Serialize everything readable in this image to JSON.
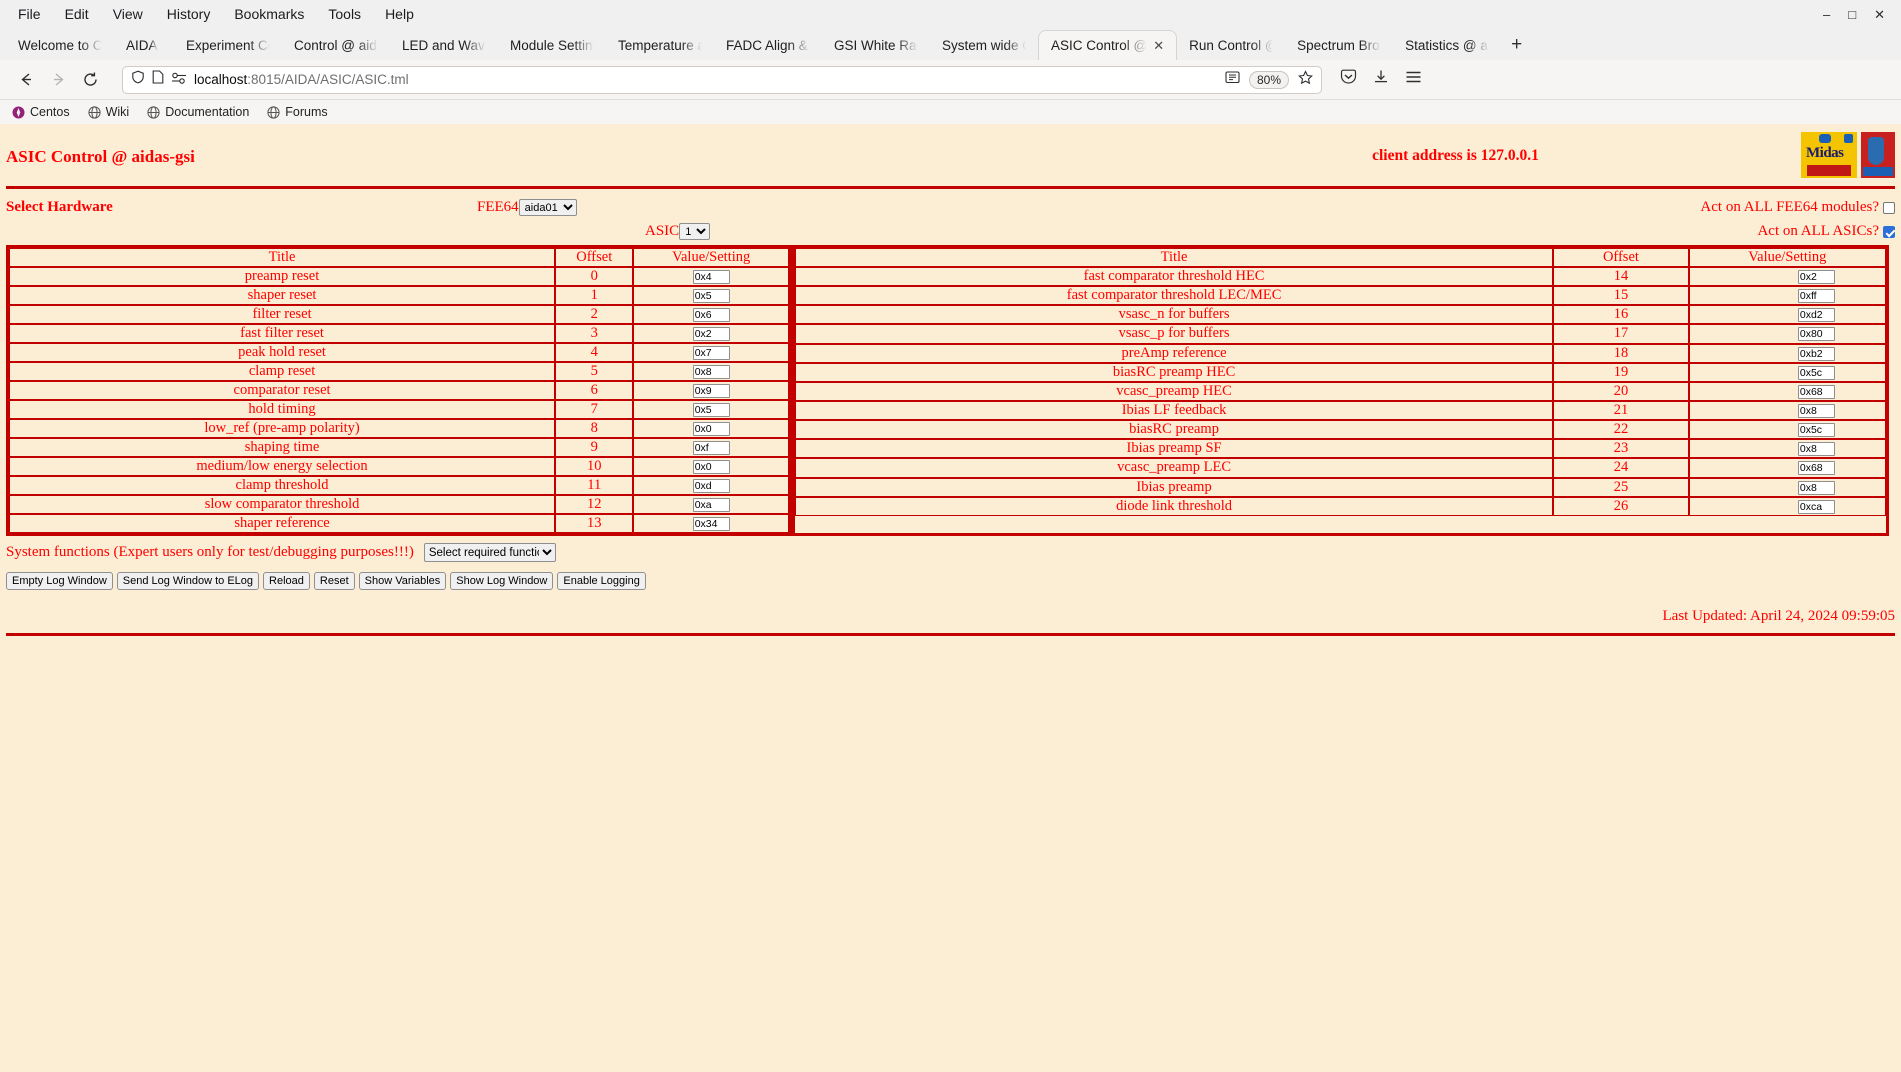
{
  "browser": {
    "menus": [
      "File",
      "Edit",
      "View",
      "History",
      "Bookmarks",
      "Tools",
      "Help"
    ],
    "window_controls": {
      "minimize": "–",
      "maximize": "□",
      "close": "✕"
    },
    "tabs": [
      {
        "label": "Welcome to Cent",
        "active": false
      },
      {
        "label": "AIDA",
        "active": false
      },
      {
        "label": "Experiment Contr",
        "active": false
      },
      {
        "label": "Control @ aidas-",
        "active": false
      },
      {
        "label": "LED and Wavefor",
        "active": false
      },
      {
        "label": "Module Settings ",
        "active": false
      },
      {
        "label": "Temperature and",
        "active": false
      },
      {
        "label": "FADC Align & Co",
        "active": false
      },
      {
        "label": "GSI White Rabbit",
        "active": false
      },
      {
        "label": "System wide Che",
        "active": false
      },
      {
        "label": "ASIC Control @",
        "active": true
      },
      {
        "label": "Run Control @ ai",
        "active": false
      },
      {
        "label": "Spectrum Brows",
        "active": false
      },
      {
        "label": "Statistics @ aidas",
        "active": false
      }
    ],
    "new_tab_label": "+",
    "url_host": "localhost",
    "url_path": ":8015/AIDA/ASIC/ASIC.tml",
    "zoom_level": "80%",
    "bookmarks": [
      "Centos",
      "Wiki",
      "Documentation",
      "Forums"
    ]
  },
  "page": {
    "title": "ASIC Control @ aidas-gsi",
    "client_address": "client address is 127.0.0.1",
    "select_hardware_label": "Select Hardware",
    "fee64_label": "FEE64",
    "fee64_value": "aida01",
    "asic_label": "ASIC",
    "asic_value": "1",
    "act_all_fee64_label": "Act on ALL FEE64 modules?",
    "act_all_fee64_checked": false,
    "act_all_asics_label": "Act on ALL ASICs?",
    "act_all_asics_checked": true,
    "columns": {
      "title": "Title",
      "offset": "Offset",
      "value": "Value/Setting"
    },
    "rows_left": [
      {
        "title": "preamp reset",
        "offset": "0",
        "value": "0x4"
      },
      {
        "title": "shaper reset",
        "offset": "1",
        "value": "0x5"
      },
      {
        "title": "filter reset",
        "offset": "2",
        "value": "0x6"
      },
      {
        "title": "fast filter reset",
        "offset": "3",
        "value": "0x2"
      },
      {
        "title": "peak hold reset",
        "offset": "4",
        "value": "0x7"
      },
      {
        "title": "clamp reset",
        "offset": "5",
        "value": "0x8"
      },
      {
        "title": "comparator reset",
        "offset": "6",
        "value": "0x9"
      },
      {
        "title": "hold timing",
        "offset": "7",
        "value": "0x5"
      },
      {
        "title": "low_ref (pre-amp polarity)",
        "offset": "8",
        "value": "0x0"
      },
      {
        "title": "shaping time",
        "offset": "9",
        "value": "0xf"
      },
      {
        "title": "medium/low energy selection",
        "offset": "10",
        "value": "0x0"
      },
      {
        "title": "clamp threshold",
        "offset": "11",
        "value": "0xd"
      },
      {
        "title": "slow comparator threshold",
        "offset": "12",
        "value": "0xa"
      },
      {
        "title": "shaper reference",
        "offset": "13",
        "value": "0x34"
      }
    ],
    "rows_right": [
      {
        "title": "fast comparator threshold HEC",
        "offset": "14",
        "value": "0x2"
      },
      {
        "title": "fast comparator threshold LEC/MEC",
        "offset": "15",
        "value": "0xff"
      },
      {
        "title": "vsasc_n for buffers",
        "offset": "16",
        "value": "0xd2"
      },
      {
        "title": "vsasc_p for buffers",
        "offset": "17",
        "value": "0x80"
      },
      {
        "title": "preAmp reference",
        "offset": "18",
        "value": "0xb2"
      },
      {
        "title": "biasRC preamp HEC",
        "offset": "19",
        "value": "0x5c"
      },
      {
        "title": "vcasc_preamp HEC",
        "offset": "20",
        "value": "0x68"
      },
      {
        "title": "Ibias LF feedback",
        "offset": "21",
        "value": "0x8"
      },
      {
        "title": "biasRC preamp",
        "offset": "22",
        "value": "0x5c"
      },
      {
        "title": "Ibias preamp SF",
        "offset": "23",
        "value": "0x8"
      },
      {
        "title": "vcasc_preamp LEC",
        "offset": "24",
        "value": "0x68"
      },
      {
        "title": "Ibias preamp",
        "offset": "25",
        "value": "0x8"
      },
      {
        "title": "diode link threshold",
        "offset": "26",
        "value": "0xca"
      }
    ],
    "sysfunc_label": "System functions (Expert users only for test/debugging purposes!!!)",
    "sysfunc_select_value": "Select required function",
    "buttons": [
      "Empty Log Window",
      "Send Log Window to ELog",
      "Reload",
      "Reset",
      "Show Variables",
      "Show Log Window",
      "Enable Logging"
    ],
    "last_updated": "Last Updated: April 24, 2024 09:59:05"
  },
  "colors": {
    "page_bg": "#fceed4",
    "accent_red": "#ff0000",
    "border_red": "#c20000",
    "checkbox_blue": "#2d6fd8"
  }
}
